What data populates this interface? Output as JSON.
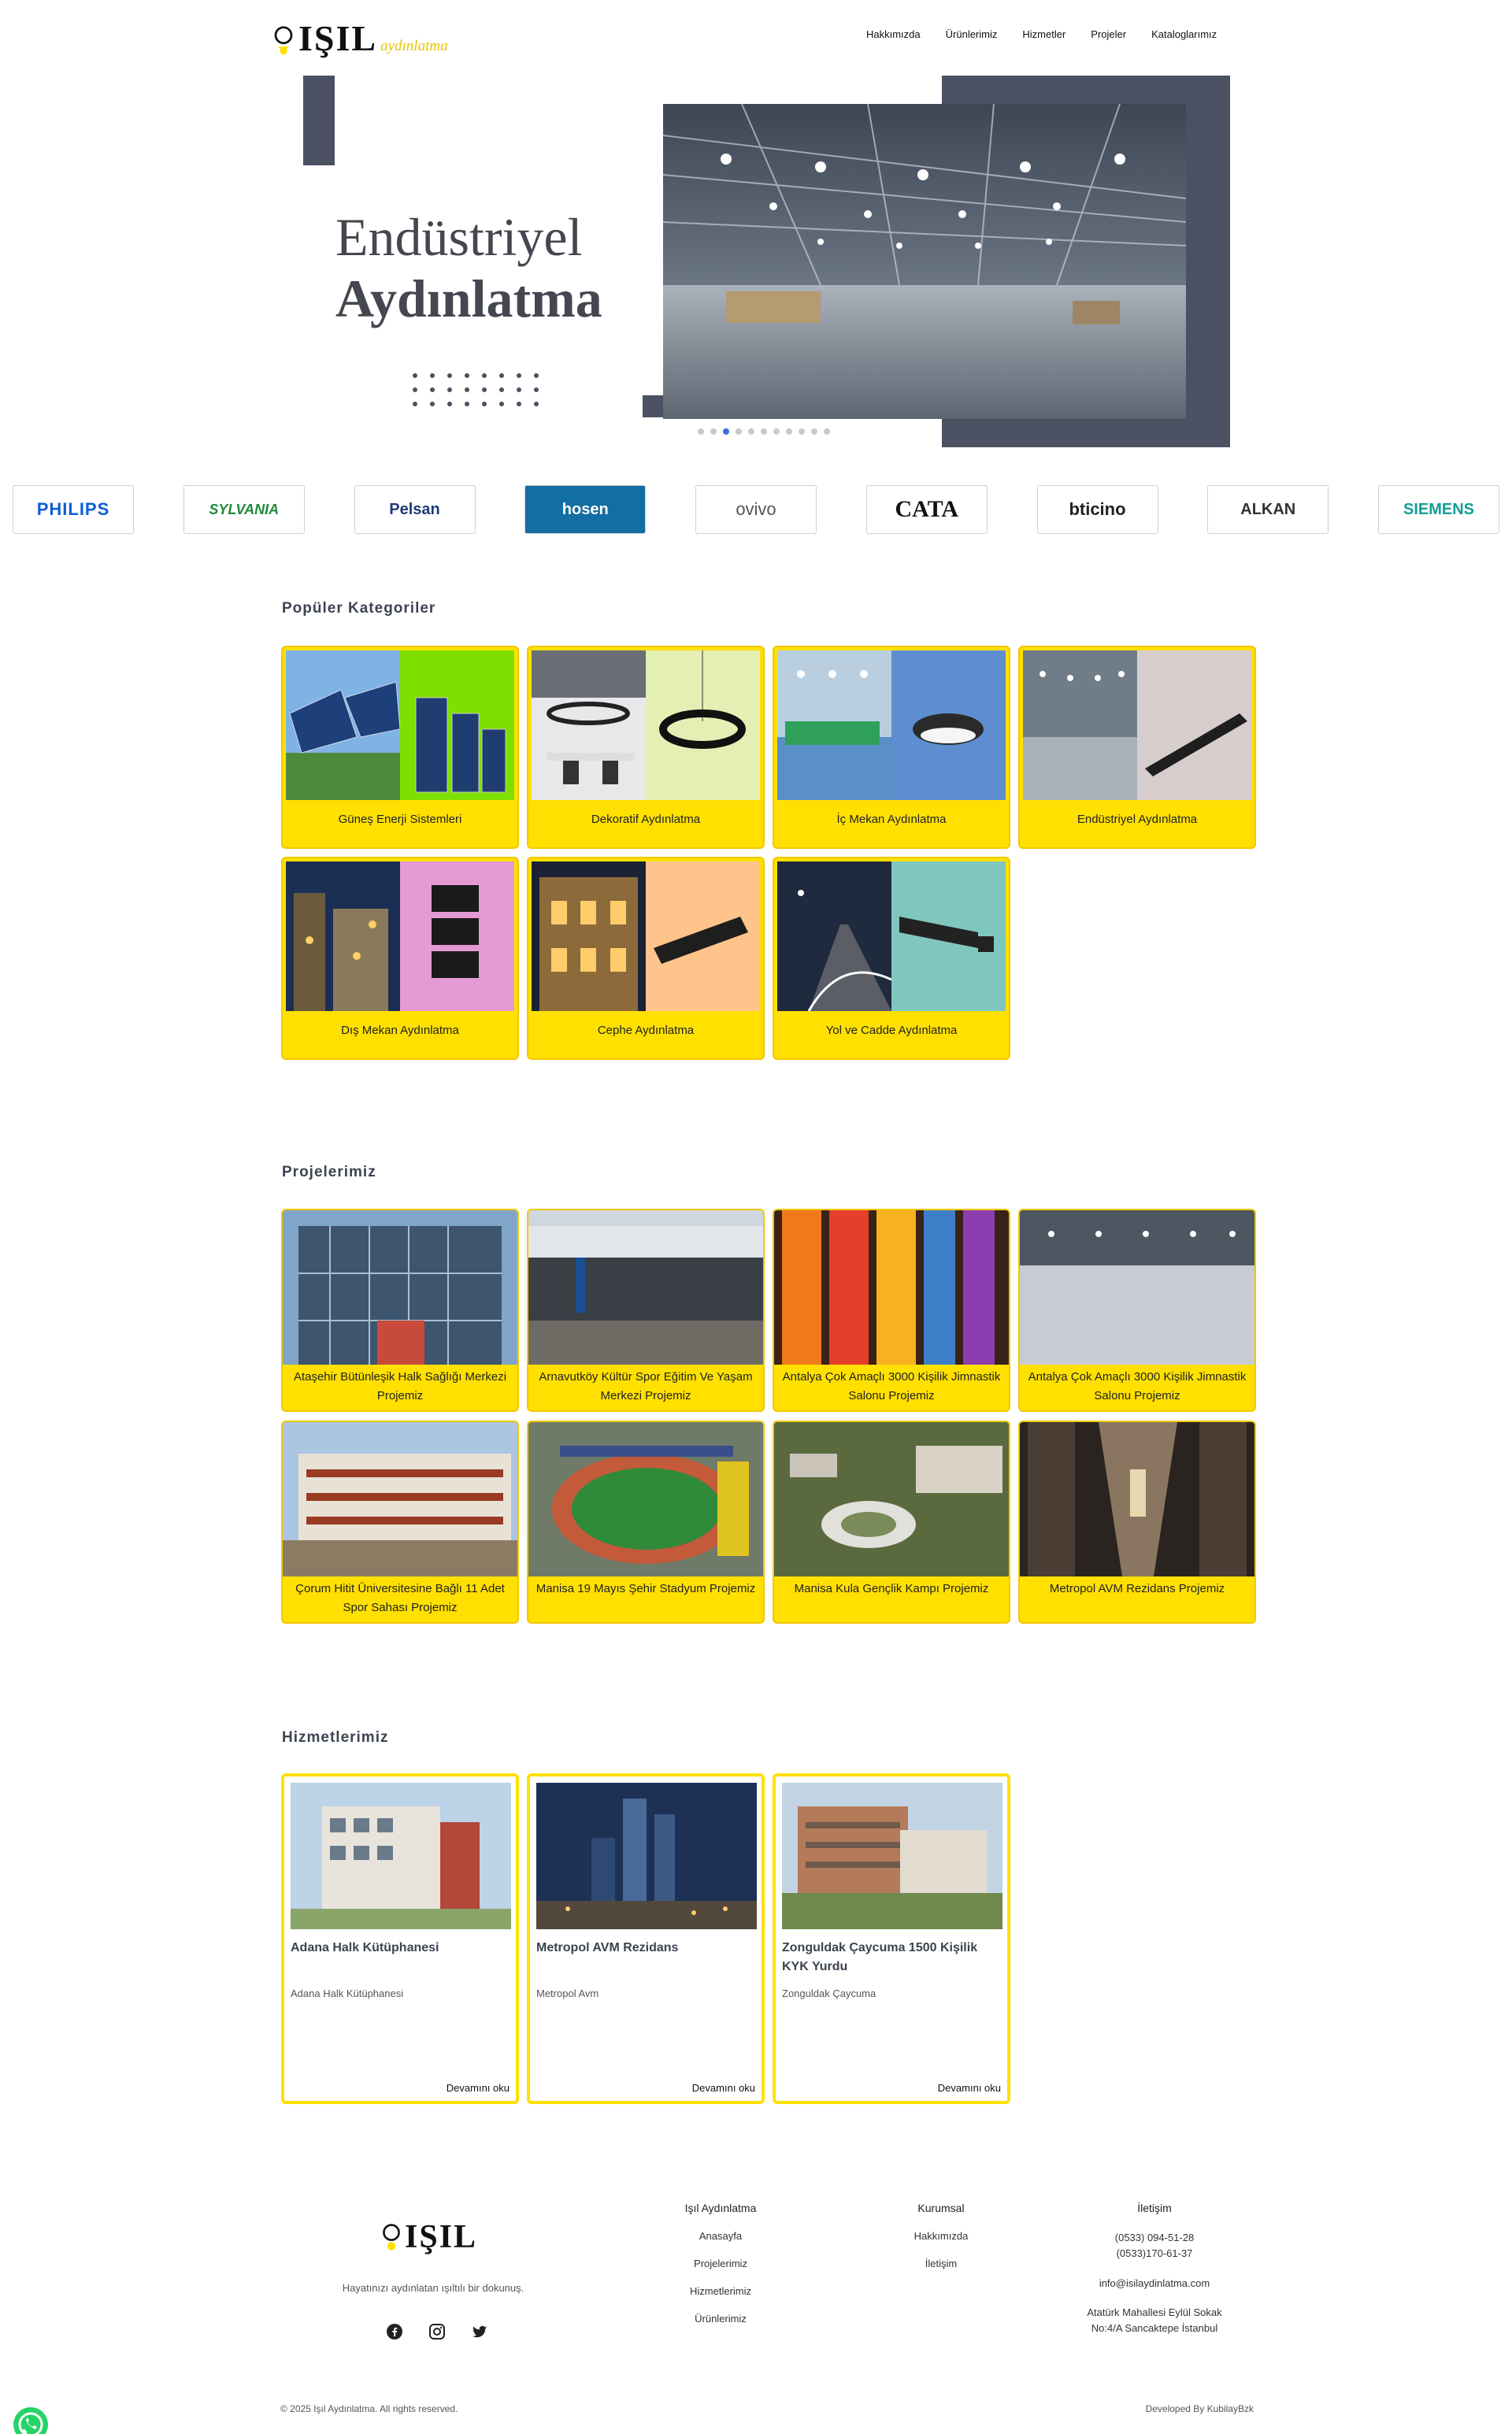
{
  "header": {
    "logo_big": "IŞIL",
    "logo_small": "aydınlatma",
    "nav": [
      "Hakkımızda",
      "Ürünlerimiz",
      "Hizmetler",
      "Projeler",
      "Kataloglarımız"
    ]
  },
  "hero": {
    "line1": "Endüstriyel",
    "line2": "Aydınlatma",
    "slides": 11,
    "active_slide": 3
  },
  "brands": [
    "PHILIPS",
    "SYLVANIA",
    "Pelsan",
    "hosen",
    "ovivo",
    "CATA",
    "bticino",
    "ALKAN",
    "SIEMENS"
  ],
  "categories": {
    "title": "Popüler Kategoriler",
    "items": [
      "Güneş Enerji Sistemleri",
      "Dekoratif Aydınlatma",
      "İç Mekan Aydınlatma",
      "Endüstriyel Aydınlatma",
      "Dış Mekan Aydınlatma",
      "Cephe Aydınlatma",
      "Yol ve Cadde Aydınlatma"
    ]
  },
  "projects": {
    "title": "Projelerimiz",
    "items": [
      "Ataşehir Bütünleşik Halk Sağlığı Merkezi Projemiz",
      "Arnavutköy Kültür Spor Eğitim Ve Yaşam Merkezi Projemiz",
      "Antalya Çok Amaçlı 3000 Kişilik Jimnastik Salonu Projemiz",
      "Antalya Çok Amaçlı 3000 Kişilik Jimnastik Salonu Projemiz",
      "Çorum Hitit Üniversitesine Bağlı 11 Adet Spor Sahası Projemiz",
      "Manisa 19 Mayıs Şehir Stadyum Projemiz",
      "Manisa Kula Gençlik Kampı Projemiz",
      "Metropol AVM Rezidans Projemiz"
    ]
  },
  "services": {
    "title": "Hizmetlerimiz",
    "items": [
      {
        "title": "Adana Halk Kütüphanesi",
        "desc": "Adana Halk Kütüphanesi",
        "more": "Devamını oku"
      },
      {
        "title": "Metropol AVM Rezidans",
        "desc": "Metropol Avm",
        "more": "Devamını oku"
      },
      {
        "title": "Zonguldak Çaycuma 1500 Kişilik KYK Yurdu",
        "desc": "Zonguldak Çaycuma",
        "more": "Devamını oku"
      }
    ]
  },
  "footer": {
    "logo": "IŞIL",
    "tagline": "Hayatınızı aydınlatan ışıltılı bir dokunuş.",
    "col1": {
      "title": "Işıl Aydınlatma",
      "items": [
        "Anasayfa",
        "Projelerimiz",
        "Hizmetlerimiz",
        "Ürünlerimiz"
      ]
    },
    "col2": {
      "title": "Kurumsal",
      "items": [
        "Hakkımızda",
        "İletişim"
      ]
    },
    "col3": {
      "title": "İletişim",
      "phone1": "(0533) 094-51-28",
      "phone2": "(0533)170-61-37",
      "email": "info@isilaydinlatma.com",
      "addr1": "Atatürk Mahallesi Eylül Sokak",
      "addr2": "No:4/A Sancaktepe İstanbul"
    },
    "copyright": "© 2025  Işıl Aydınlatma. All rights reserved.",
    "developer": "Developed By  KubilayBzk"
  },
  "colors": {
    "accent": "#ffe000",
    "slate": "#4b5162",
    "border": "#f1c800"
  }
}
